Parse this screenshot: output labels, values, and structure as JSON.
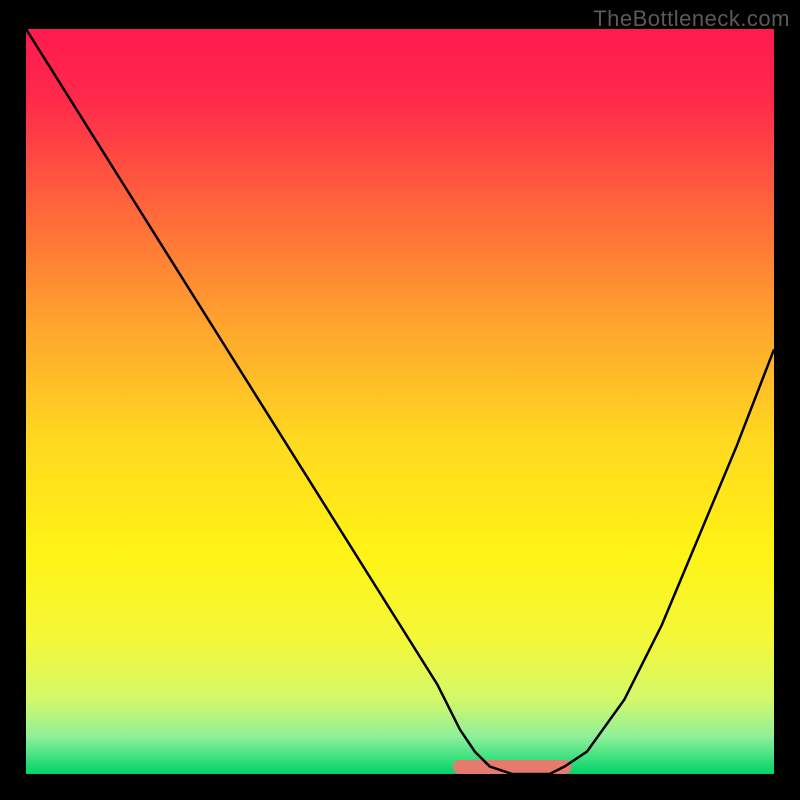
{
  "watermark": "TheBottleneck.com",
  "chart_data": {
    "type": "line",
    "title": "",
    "xlabel": "",
    "ylabel": "",
    "xlim": [
      0,
      100
    ],
    "ylim": [
      0,
      100
    ],
    "x": [
      0,
      5,
      10,
      15,
      20,
      25,
      30,
      35,
      40,
      45,
      50,
      55,
      58,
      60,
      62,
      65,
      68,
      70,
      72,
      75,
      80,
      85,
      90,
      95,
      100
    ],
    "values": [
      100,
      92,
      84,
      76,
      68,
      60,
      52,
      44,
      36,
      28,
      20,
      12,
      6,
      3,
      1,
      0,
      0,
      0,
      1,
      3,
      10,
      20,
      32,
      44,
      57
    ],
    "gradient_stops": [
      {
        "pos": 0.0,
        "color": "#ff1a4f"
      },
      {
        "pos": 0.1,
        "color": "#ff2b4a"
      },
      {
        "pos": 0.25,
        "color": "#ff6a3a"
      },
      {
        "pos": 0.4,
        "color": "#ffa52e"
      },
      {
        "pos": 0.55,
        "color": "#ffd820"
      },
      {
        "pos": 0.7,
        "color": "#fff314"
      },
      {
        "pos": 0.82,
        "color": "#f4f83a"
      },
      {
        "pos": 0.9,
        "color": "#d4f86a"
      },
      {
        "pos": 0.95,
        "color": "#8ef09a"
      },
      {
        "pos": 1.0,
        "color": "#00d36a"
      }
    ],
    "bottom_band": {
      "color": "#e77a6f",
      "x_range": [
        58,
        72
      ],
      "y": 0,
      "thickness": 2
    }
  }
}
